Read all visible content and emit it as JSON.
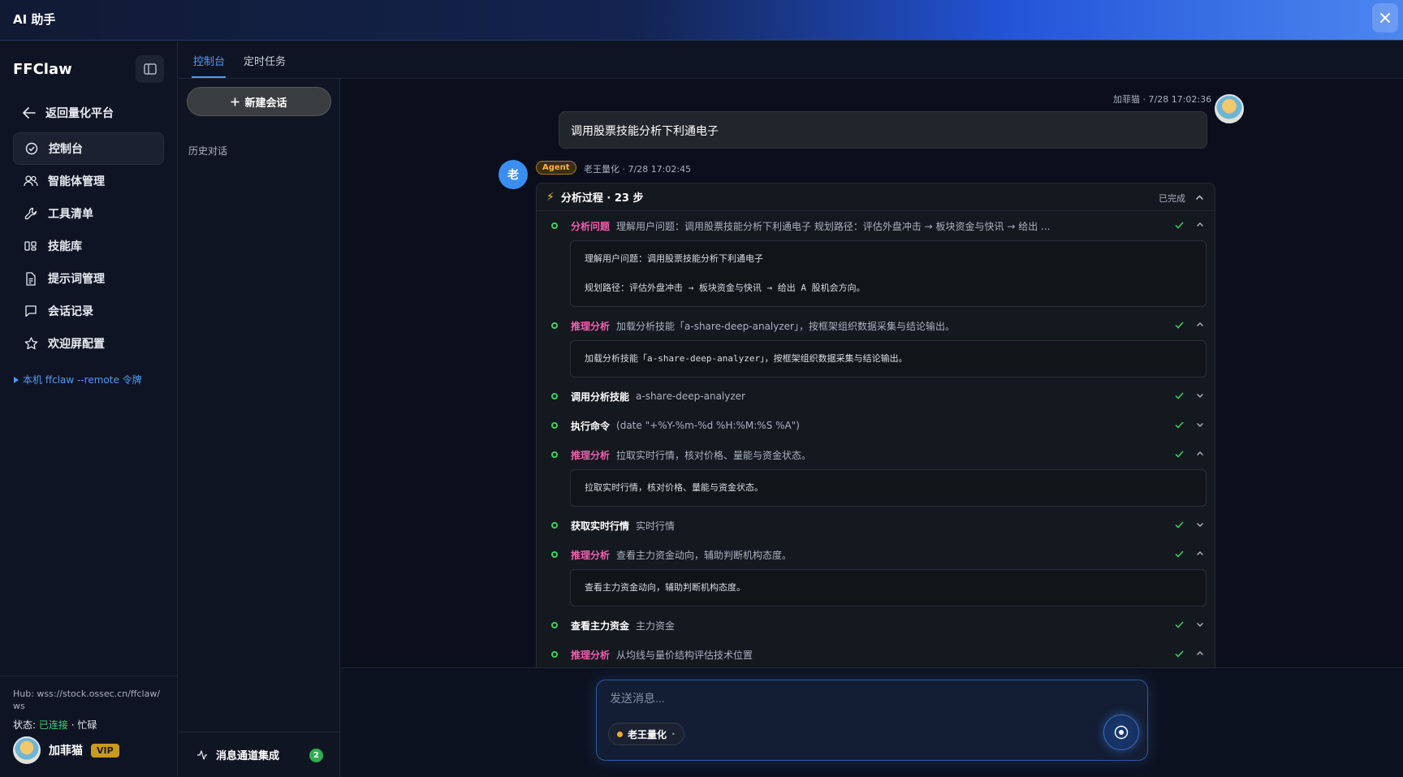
{
  "window": {
    "title": "AI 助手",
    "close_icon": "close-icon"
  },
  "sidebar": {
    "brand": "FFClaw",
    "back_label": "返回量化平台",
    "items": [
      {
        "label": "控制台",
        "icon": "dashboard-icon",
        "active": true
      },
      {
        "label": "智能体管理",
        "icon": "users-icon",
        "active": false
      },
      {
        "label": "工具清单",
        "icon": "wrench-icon",
        "active": false
      },
      {
        "label": "技能库",
        "icon": "skills-icon",
        "active": false
      },
      {
        "label": "提示词管理",
        "icon": "document-icon",
        "active": false
      },
      {
        "label": "会话记录",
        "icon": "chat-icon",
        "active": false
      },
      {
        "label": "欢迎屏配置",
        "icon": "star-icon",
        "active": false
      }
    ],
    "token_link": "本机 ffclaw --remote 令牌",
    "hub": "Hub: wss://stock.ossec.cn/ffclaw/ws",
    "status_label": "状态:",
    "status_value": "已连接",
    "status_extra": "· 忙碌",
    "user": {
      "name": "加菲猫",
      "badge": "VIP"
    }
  },
  "tabs": [
    {
      "label": "控制台",
      "active": true
    },
    {
      "label": "定时任务",
      "active": false
    }
  ],
  "conversations": {
    "new_chat": "新建会话",
    "history_label": "历史对话",
    "channel_label": "消息通道集成",
    "channel_count": "2"
  },
  "chat": {
    "user_message": {
      "meta": "加菲猫 · 7/28 17:02:36",
      "text": "调用股票技能分析下利通电子"
    },
    "agent": {
      "avatar_text": "老",
      "badge": "Agent",
      "meta": "老王量化 · 7/28 17:02:45"
    },
    "process": {
      "title": "分析过程 · 23 步",
      "status": "已完成"
    },
    "steps": [
      {
        "label": "分析问题",
        "kind": "reason",
        "summary": "理解用户问题：调用股票技能分析下利通电子 规划路径：评估外盘冲击 → 板块资金与快讯 → 给出 ...",
        "expanded": true,
        "body": "理解用户问题：调用股票技能分析下利通电子\n\n规划路径：评估外盘冲击 → 板块资金与快讯 → 给出 A 股机会方向。"
      },
      {
        "label": "推理分析",
        "kind": "reason",
        "summary": "加载分析技能「a-share-deep-analyzer」，按框架组织数据采集与结论输出。",
        "expanded": true,
        "body": "加载分析技能「a-share-deep-analyzer」，按框架组织数据采集与结论输出。"
      },
      {
        "label": "调用分析技能",
        "kind": "action",
        "summary": "a-share-deep-analyzer",
        "expanded": false,
        "body": ""
      },
      {
        "label": "执行命令",
        "kind": "action",
        "summary": "(date \"+%Y-%m-%d %H:%M:%S %A\")",
        "expanded": false,
        "body": ""
      },
      {
        "label": "推理分析",
        "kind": "reason",
        "summary": "拉取实时行情，核对价格、量能与资金状态。",
        "expanded": true,
        "body": "拉取实时行情，核对价格、量能与资金状态。"
      },
      {
        "label": "获取实时行情",
        "kind": "action",
        "summary": "实时行情",
        "expanded": false,
        "body": ""
      },
      {
        "label": "推理分析",
        "kind": "reason",
        "summary": "查看主力资金动向，辅助判断机构态度。",
        "expanded": true,
        "body": "查看主力资金动向，辅助判断机构态度。"
      },
      {
        "label": "查看主力资金",
        "kind": "action",
        "summary": "主力资金",
        "expanded": false,
        "body": ""
      },
      {
        "label": "推理分析",
        "kind": "reason",
        "summary": "从均线与量价结构评估技术位置",
        "expanded": true,
        "body": "从均线与量价结构评估技术位置"
      }
    ]
  },
  "composer": {
    "placeholder": "发送消息...",
    "agent_chip": "老王量化",
    "send_icon": "send-icon"
  },
  "colors": {
    "accent": "#4f9cf7",
    "reason": "#f15fae",
    "success": "#3fcf64",
    "vip": "#c99a1d"
  }
}
